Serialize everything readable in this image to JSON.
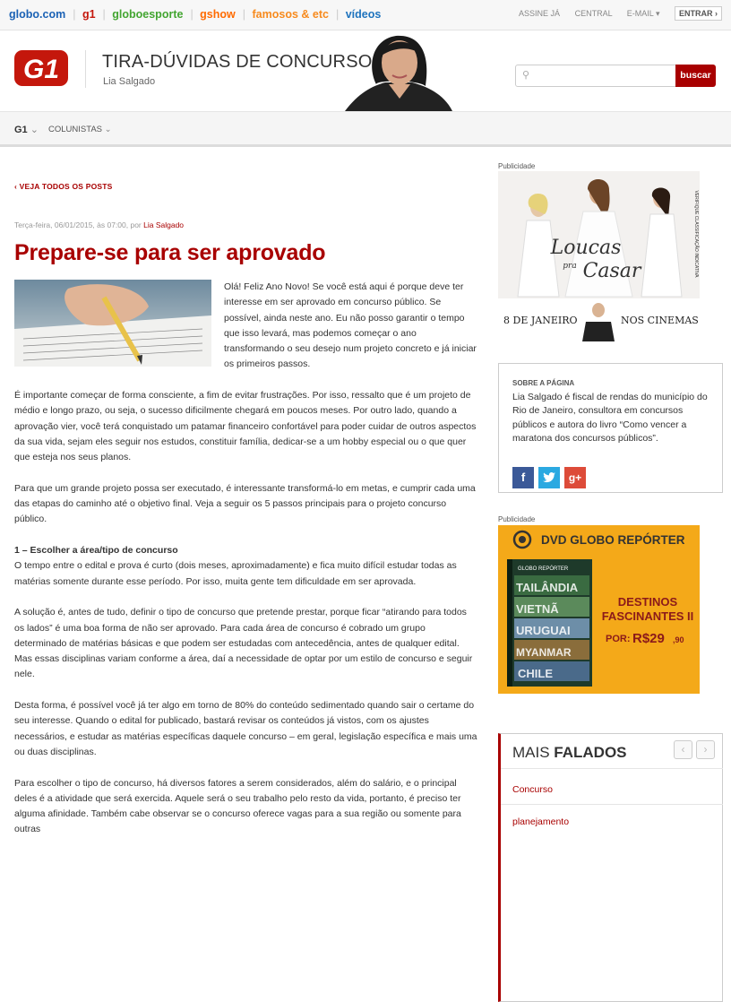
{
  "globobar": {
    "links": [
      {
        "label": "globo.com",
        "color": "#1b62b5"
      },
      {
        "label": "g1",
        "color": "#c4170c"
      },
      {
        "label": "globoesporte",
        "color": "#43a531"
      },
      {
        "label": "gshow",
        "color": "#ff6b00"
      },
      {
        "label": "famosos & etc",
        "color": "#f78a1d"
      },
      {
        "label": "vídeos",
        "color": "#1e73be"
      }
    ],
    "assine": "ASSINE JÁ",
    "central": "CENTRAL",
    "email": "E-MAIL",
    "entrar": "ENTRAR"
  },
  "header": {
    "logo": "G1",
    "title": "TIRA-DÚVIDAS DE CONCURSOS",
    "author": "Lia Salgado",
    "search_button": "buscar"
  },
  "nav": {
    "g1": "G1",
    "colunistas": "COLUNISTAS"
  },
  "post": {
    "back": "VEJA TODOS OS POSTS",
    "meta": "Terça-feira, 06/01/2015, às 07:00, por",
    "author": "Lia Salgado",
    "title": "Prepare-se para ser aprovado",
    "p1": "Olá! Feliz Ano Novo! Se você está aqui é porque deve ter interesse em ser aprovado em concurso público. Se possível, ainda neste ano. Eu não posso garantir o tempo que isso levará, mas podemos começar o ano transformando o seu desejo num projeto concreto e já iniciar os primeiros passos.",
    "p2": "É importante começar de forma consciente, a fim de evitar frustrações. Por isso, ressalto que é um projeto de médio e longo prazo, ou seja, o sucesso dificilmente chegará em poucos meses. Por outro lado, quando a aprovação vier, você terá conquistado um patamar financeiro confortável para poder cuidar de outros aspectos da sua vida, sejam eles seguir nos estudos, constituir família, dedicar-se a um hobby especial ou o que quer que esteja nos seus planos.",
    "p3": "Para que um grande projeto possa ser executado, é interessante transformá-lo em metas, e cumprir cada uma das etapas do caminho até o objetivo final. Veja a seguir os 5 passos principais para o projeto concurso público.",
    "h1": "1 – Escolher a área/tipo de concurso",
    "p4": "O tempo entre o edital e prova é curto (dois meses, aproximadamente) e fica muito difícil estudar todas as matérias somente durante esse período. Por isso, muita gente tem dificuldade em ser aprovada.",
    "p5": "A solução é, antes de tudo, definir o tipo de concurso que pretende prestar, porque ficar “atirando para todos os lados” é uma boa forma de não ser aprovado. Para cada área de concurso é cobrado um grupo determinado de matérias básicas e que podem ser estudadas com antecedência, antes de qualquer edital. Mas essas disciplinas variam conforme a área, daí a necessidade de optar por um estilo de concurso e seguir nele.",
    "p6": "Desta forma, é possível você já ter algo em torno de 80% do conteúdo sedimentado quando sair o certame do seu interesse. Quando o edital for publicado, bastará revisar os conteúdos já vistos, com os ajustes necessários, e estudar as matérias específicas daquele concurso – em geral, legislação específica e mais uma ou duas disciplinas.",
    "p7": "Para escolher o tipo de concurso, há diversos fatores a serem considerados, além do salário, e o principal deles é a atividade que será exercida. Aquele será o seu trabalho pelo resto da vida, portanto, é preciso ter alguma afinidade. Também cabe observar se o concurso oferece vagas para a sua região ou somente para outras"
  },
  "sidebar": {
    "pub1": "Publicidade",
    "ad1": {
      "title1": "Loucas",
      "title2": "pra",
      "title3": "Casar",
      "date": "8 DE JANEIRO",
      "cinemas": "NOS CINEMAS",
      "classif": "VERIFIQUE CLASSIFICAÇÃO INDICATIVA"
    },
    "about_heading": "SOBRE A PÁGINA",
    "about_text": "Lia Salgado é fiscal de rendas do município do Rio de Janeiro, consultora em concursos públicos e autora do livro “Como vencer a maratona dos concursos públicos”.",
    "pub2": "Publicidade",
    "ad2": {
      "brand": "DVD GLOBO REPÓRTER",
      "cover_title": "GLOBO REPÓRTER",
      "places": [
        "TAILÂNDIA",
        "VIETNÃ",
        "URUGUAI",
        "MYANMAR",
        "CHILE"
      ],
      "h1": "DESTINOS",
      "h2": "FASCINANTES II",
      "por": "POR:",
      "price": "R$29",
      "cents": ",90"
    },
    "mais_light": "MAIS",
    "mais_bold": "FALADOS",
    "mais_items": [
      "Concurso",
      "planejamento"
    ]
  },
  "colors": {
    "accent": "#a80000",
    "ad_orange": "#f4a919"
  }
}
